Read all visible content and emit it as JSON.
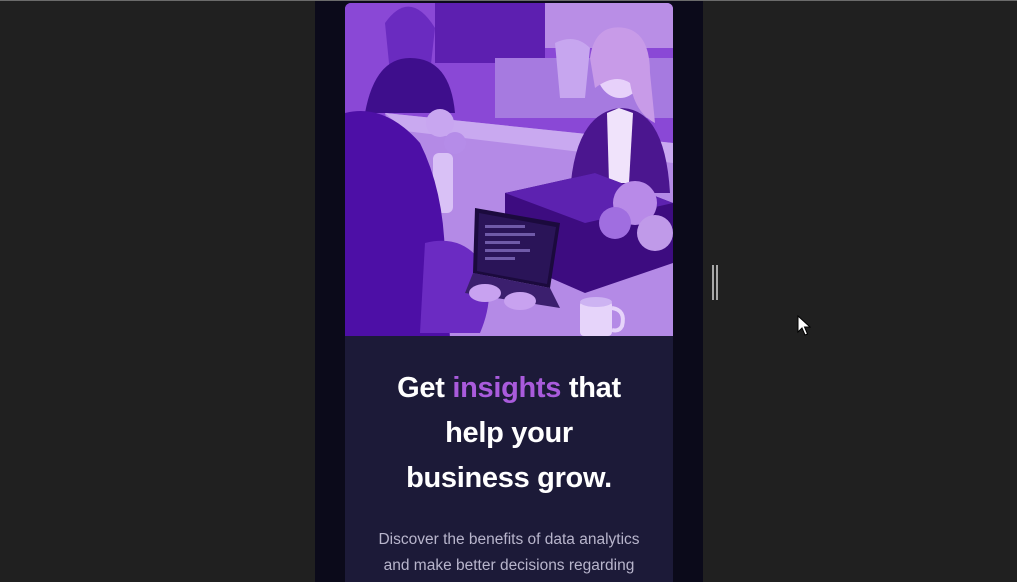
{
  "hero": {
    "image": "team-at-laptops-photo",
    "tint_color": "#7b35d0"
  },
  "headline": {
    "prefix": "Get ",
    "highlight": "insights",
    "suffix_line1": " that",
    "line2": "help your",
    "line3": "business grow.",
    "accent_color": "#a95bdc"
  },
  "description": "Discover the benefits of data analytics and make better decisions regarding revenue, customer experience, and",
  "icons": {
    "resize_handle": "resize-handle-icon",
    "cursor": "mouse-pointer-icon"
  }
}
